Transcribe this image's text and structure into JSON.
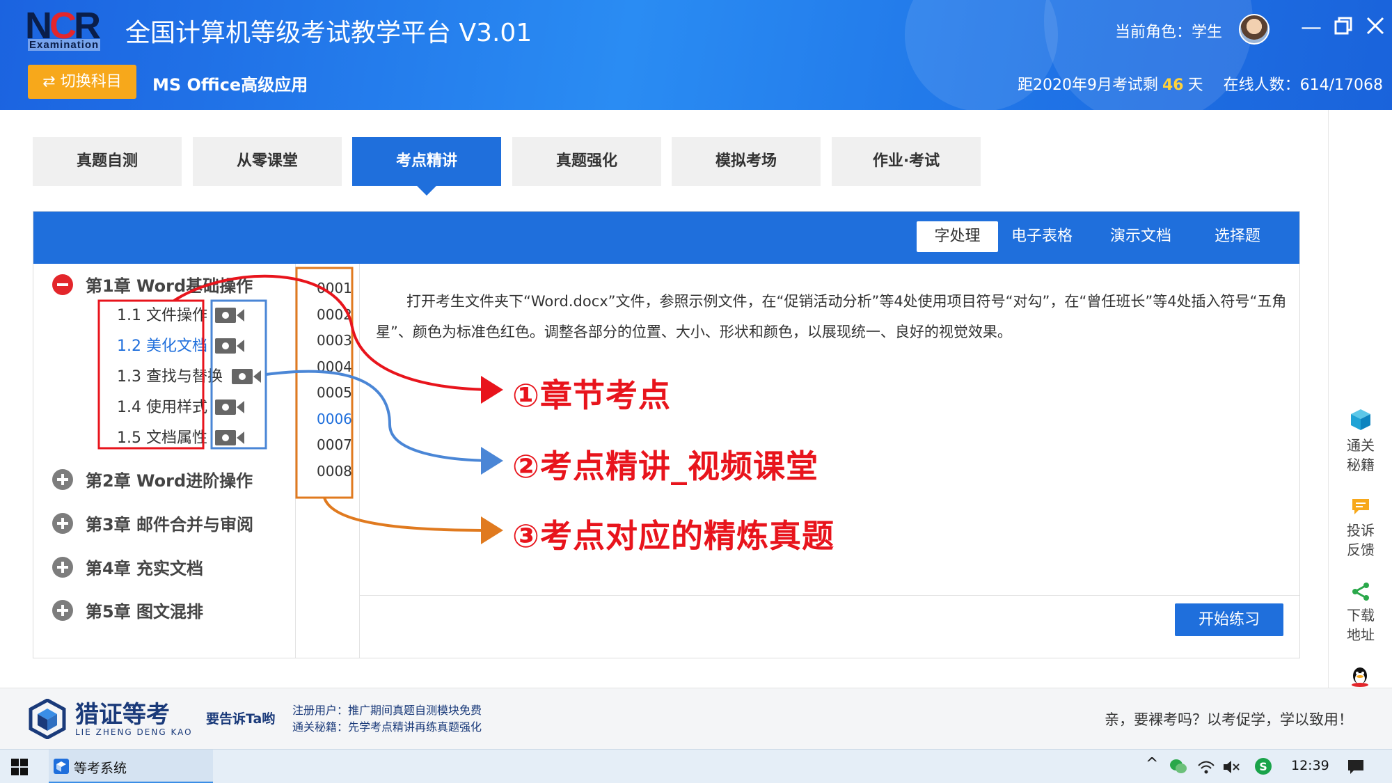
{
  "header": {
    "logo_text": "NCR",
    "logo_sub": "Examination",
    "app_title": "全国计算机等级考试教学平台 V3.01",
    "role_label": "当前角色：学生",
    "switch_label": "切换科目",
    "subject": "MS Office高级应用",
    "countdown_prefix": "距2020年9月考试剩",
    "countdown_days": "46",
    "countdown_suffix": "天",
    "online": "在线人数：614/17068"
  },
  "main_tabs": [
    "真题自测",
    "从零课堂",
    "考点精讲",
    "真题强化",
    "模拟考场",
    "作业·考试"
  ],
  "active_tab": "考点精讲",
  "sub_tabs": [
    "字处理",
    "电子表格",
    "演示文档",
    "选择题"
  ],
  "active_subtab": "字处理",
  "chapters": [
    {
      "title": "第1章 Word基础操作",
      "expanded": true,
      "sections": [
        "1.1 文件操作",
        "1.2 美化文档",
        "1.3 查找与替换",
        "1.4 使用样式",
        "1.5 文档属性"
      ]
    },
    {
      "title": "第2章 Word进阶操作",
      "expanded": false
    },
    {
      "title": "第3章 邮件合并与审阅",
      "expanded": false
    },
    {
      "title": "第4章 充实文档",
      "expanded": false
    },
    {
      "title": "第5章 图文混排",
      "expanded": false
    }
  ],
  "selected_section": "1.2 美化文档",
  "question_numbers": [
    "0001",
    "0002",
    "0003",
    "0004",
    "0005",
    "0006",
    "0007",
    "0008"
  ],
  "selected_question": "0006",
  "question_text": "打开考生文件夹下“Word.docx”文件，参照示例文件，在“促销活动分析”等4处使用项目符号“对勾”，在“曾任班长”等4处插入符号“五角星”、颜色为标准色红色。调整各部分的位置、大小、形状和颜色，以展现统一、良好的视觉效果。",
  "start_button": "开始练习",
  "side_tools": [
    "通关\n秘籍",
    "投诉\n反馈",
    "下载\n地址"
  ],
  "annotations": [
    "①章节考点",
    "②考点精讲_视频课堂",
    "③考点对应的精炼真题"
  ],
  "footer": {
    "brand": "猎证等考",
    "brand_pinyin": "LIE ZHENG DENG KAO",
    "tell": "要告诉Ta哟",
    "note1": "注册用户：推广期间真题自测模块免费",
    "note2": "通关秘籍：先学考点精讲再练真题强化",
    "slogan": "亲，要裸考吗？以考促学，学以致用！"
  },
  "taskbar": {
    "app": "等考系统",
    "clock": "12:39"
  },
  "colors": {
    "brand_blue": "#1f6fdc",
    "orange": "#f7a81b",
    "annotation_red": "#e8141c",
    "annotation_blue": "#4a86d6",
    "annotation_orange": "#e07a1f"
  }
}
